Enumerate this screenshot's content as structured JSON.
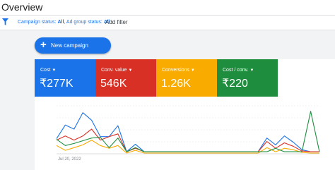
{
  "header": {
    "title": "Overview"
  },
  "filterbar": {
    "campaign_status_label": "Campaign status:",
    "campaign_status_value": "All",
    "ad_group_status_label": "Ad group status:",
    "ad_group_status_value": "All",
    "add_filter_label": "Add filter"
  },
  "toolbar": {
    "new_campaign_label": "New campaign"
  },
  "metrics": [
    {
      "label": "Cost",
      "value": "₹277K",
      "color": "#1a73e8"
    },
    {
      "label": "Conv. value",
      "value": "546K",
      "color": "#d93025"
    },
    {
      "label": "Conversions",
      "value": "1.26K",
      "color": "#f9ab00"
    },
    {
      "label": "Cost / conv.",
      "value": "₹220",
      "color": "#1e8e3e"
    }
  ],
  "chart_data": {
    "type": "line",
    "x_tick_labels": [
      "Jul 20, 2022"
    ],
    "grid": true,
    "series": [
      {
        "color": "#1a73e8",
        "values": [
          22,
          42,
          36,
          60,
          49,
          25,
          25,
          41,
          3,
          14,
          3,
          3,
          3,
          3,
          3,
          3,
          3,
          3,
          3,
          3,
          3,
          3,
          3,
          3,
          23,
          13,
          26,
          17,
          6,
          3,
          3
        ]
      },
      {
        "color": "#d93025",
        "values": [
          20,
          26,
          20,
          26,
          36,
          20,
          25,
          29,
          3,
          8,
          3,
          3,
          3,
          3,
          3,
          3,
          3,
          3,
          3,
          3,
          3,
          3,
          3,
          3,
          18,
          8,
          16,
          11,
          4,
          3,
          3
        ]
      },
      {
        "color": "#f9ab00",
        "values": [
          12,
          5,
          9,
          13,
          20,
          12,
          8,
          12,
          1,
          5,
          1,
          1,
          1,
          1,
          1,
          1,
          1,
          1,
          1,
          1,
          1,
          1,
          1,
          1,
          9,
          3,
          8,
          6,
          2,
          1,
          1
        ]
      },
      {
        "color": "#1e8e3e",
        "values": [
          21,
          12,
          15,
          19,
          23,
          24,
          9,
          23,
          3,
          9,
          3,
          3,
          3,
          3,
          3,
          3,
          3,
          3,
          3,
          3,
          3,
          3,
          3,
          3,
          3,
          8,
          3,
          3,
          3,
          62,
          3
        ]
      }
    ]
  }
}
